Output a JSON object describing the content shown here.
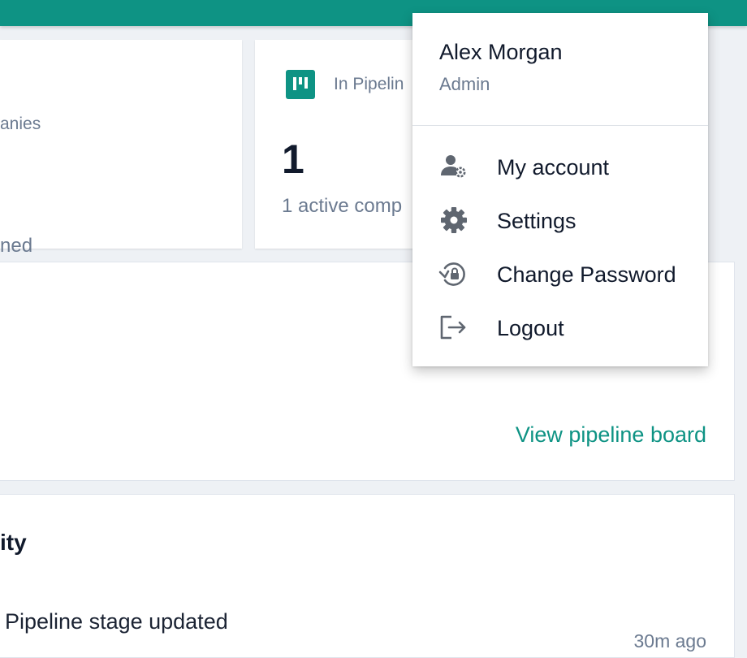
{
  "stats": {
    "companies_label": "anies",
    "companies_sub": "ned",
    "pipeline_label": "In Pipelin",
    "pipeline_value": "1",
    "pipeline_sub": "1 active comp"
  },
  "pipeline_panel": {
    "link_label": "View pipeline board"
  },
  "activity": {
    "title": "ity",
    "items": [
      {
        "text": "Pipeline stage updated",
        "time": "30m ago"
      }
    ]
  },
  "user_menu": {
    "name": "Alex Morgan",
    "role": "Admin",
    "items": [
      {
        "label": "My account",
        "icon": "user-gear-icon"
      },
      {
        "label": "Settings",
        "icon": "gear-icon"
      },
      {
        "label": "Change Password",
        "icon": "lock-reset-icon"
      },
      {
        "label": "Logout",
        "icon": "logout-icon"
      }
    ]
  },
  "colors": {
    "brand": "#0e9384",
    "text": "#111a2c",
    "muted": "#6b7a90"
  }
}
